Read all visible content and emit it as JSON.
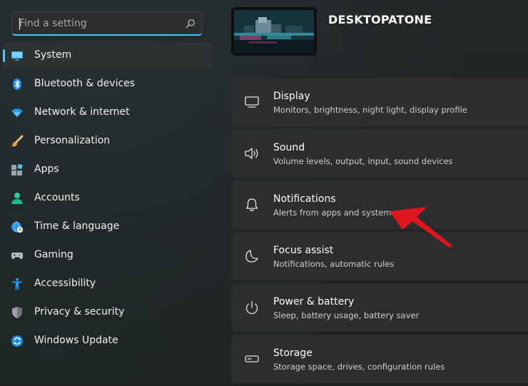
{
  "search": {
    "placeholder": "Find a setting"
  },
  "sidebar": {
    "items": [
      {
        "label": "System",
        "icon": "monitor-icon",
        "active": true
      },
      {
        "label": "Bluetooth & devices",
        "icon": "bluetooth-icon"
      },
      {
        "label": "Network & internet",
        "icon": "wifi-icon"
      },
      {
        "label": "Personalization",
        "icon": "brush-icon"
      },
      {
        "label": "Apps",
        "icon": "apps-icon"
      },
      {
        "label": "Accounts",
        "icon": "person-icon"
      },
      {
        "label": "Time & language",
        "icon": "globe-clock-icon"
      },
      {
        "label": "Gaming",
        "icon": "gamepad-icon"
      },
      {
        "label": "Accessibility",
        "icon": "accessibility-icon"
      },
      {
        "label": "Privacy & security",
        "icon": "shield-icon"
      },
      {
        "label": "Windows Update",
        "icon": "update-icon"
      }
    ]
  },
  "header": {
    "device_name": "DESKTOPATONE"
  },
  "cards": [
    {
      "title": "Display",
      "subtitle": "Monitors, brightness, night light, display profile",
      "icon": "display-icon"
    },
    {
      "title": "Sound",
      "subtitle": "Volume levels, output, input, sound devices",
      "icon": "speaker-icon"
    },
    {
      "title": "Notifications",
      "subtitle": "Alerts from apps and system",
      "icon": "bell-icon"
    },
    {
      "title": "Focus assist",
      "subtitle": "Notifications, automatic rules",
      "icon": "moon-icon"
    },
    {
      "title": "Power & battery",
      "subtitle": "Sleep, battery usage, battery saver",
      "icon": "power-icon"
    },
    {
      "title": "Storage",
      "subtitle": "Storage space, drives, configuration rules",
      "icon": "storage-icon"
    }
  ],
  "colors": {
    "accent": "#4cc2ff",
    "annotation_arrow": "#e0161e",
    "card_bg": "#2b2d2e",
    "window_bg": "#202020"
  }
}
